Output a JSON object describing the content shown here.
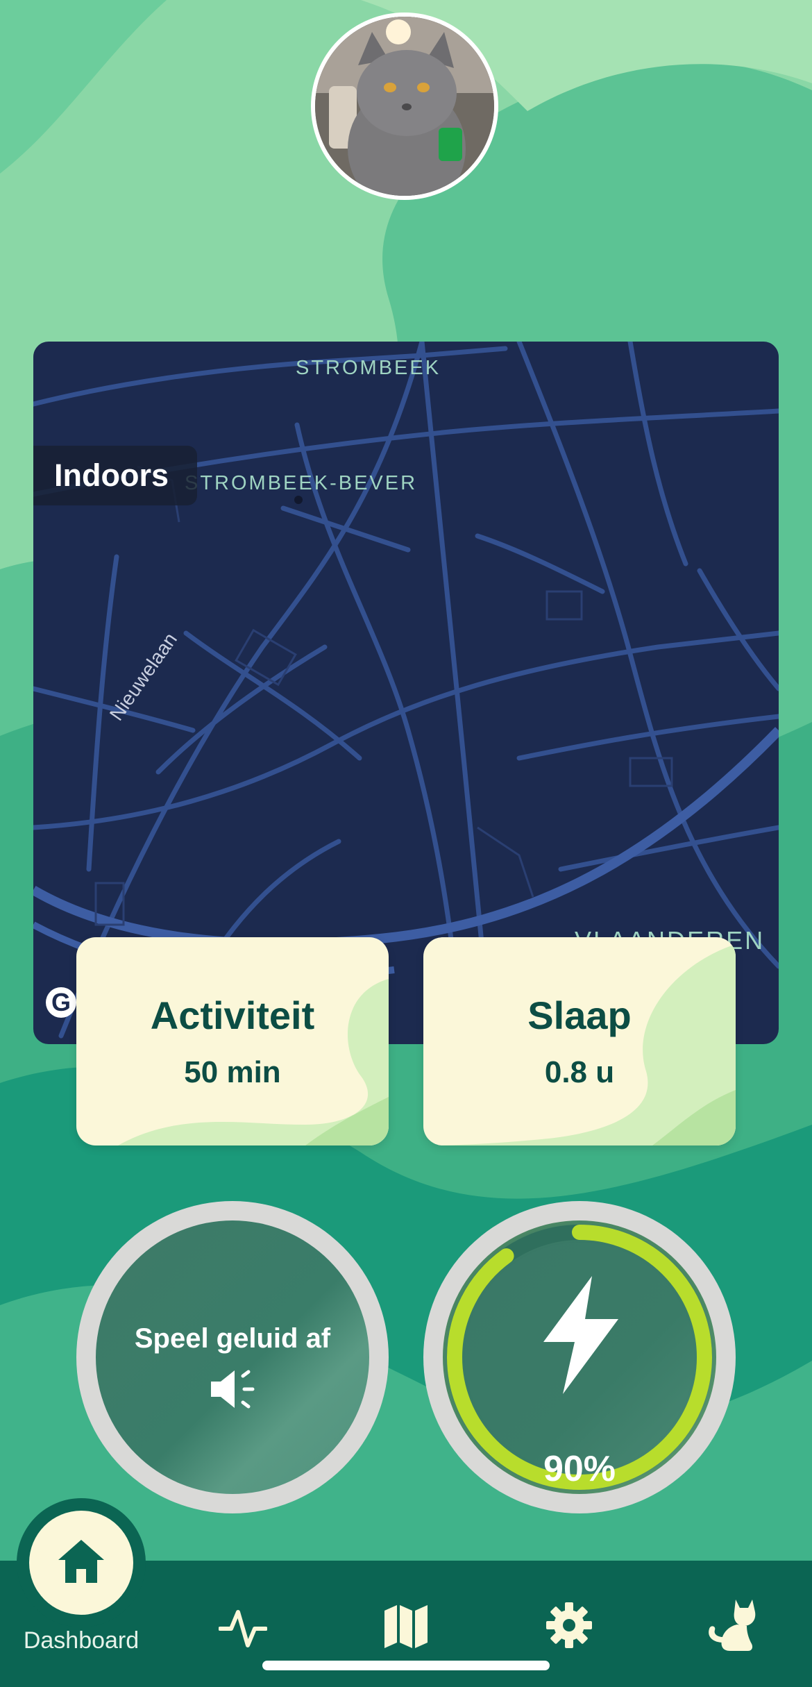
{
  "profile": {
    "avatar_alt": "cat-avatar"
  },
  "map": {
    "status_label": "Indoors",
    "places": [
      "STROMBEEK",
      "STROMBEEK-BEVER",
      "VLAANDEREN"
    ],
    "streets": [
      "Nieuwelaan"
    ],
    "attribution": "G"
  },
  "stats": {
    "activity": {
      "title": "Activiteit",
      "value": "50 min"
    },
    "sleep": {
      "title": "Slaap",
      "value": "0.8 u"
    }
  },
  "controls": {
    "sound_button_label": "Speel geluid af",
    "battery": {
      "label": "90%",
      "level": 0.9
    }
  },
  "nav": {
    "items": [
      {
        "label": "Dashboard",
        "icon": "home-icon"
      },
      {
        "label": "",
        "icon": "activity-icon"
      },
      {
        "label": "",
        "icon": "map-icon"
      },
      {
        "label": "",
        "icon": "settings-icon"
      },
      {
        "label": "",
        "icon": "cat-icon"
      }
    ]
  },
  "colors": {
    "accent_green": "#b8dd2c",
    "map_background": "#1c2a4f",
    "card_background": "#fbf7d9",
    "nav_background": "#0b6553"
  }
}
